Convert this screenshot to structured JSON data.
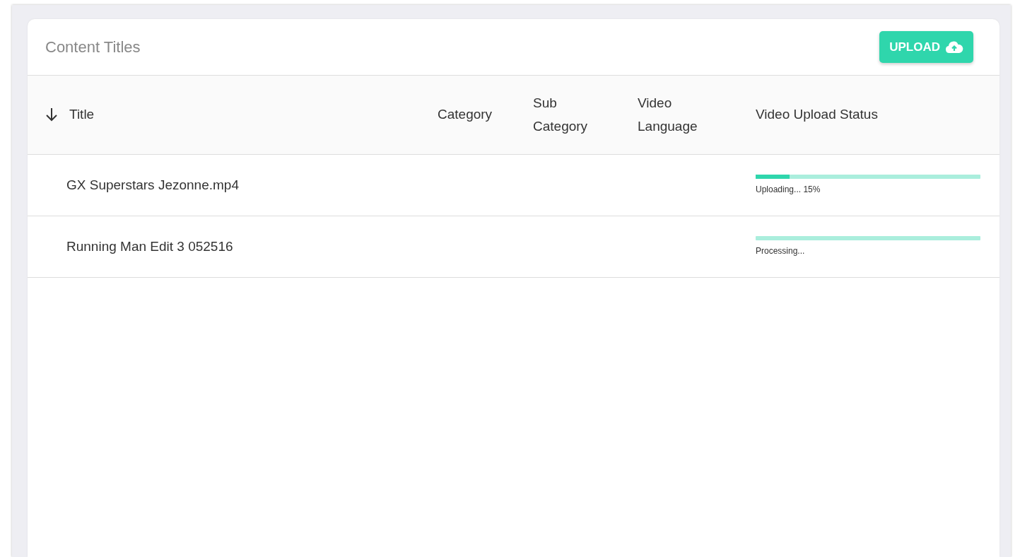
{
  "card": {
    "title": "Content Titles",
    "upload_button": "UPLOAD"
  },
  "table": {
    "columns": [
      {
        "label": "Title",
        "sorted": true
      },
      {
        "label": "Category",
        "sorted": false
      },
      {
        "label": "Sub Category",
        "sorted": false
      },
      {
        "label": "Video Language",
        "sorted": false
      },
      {
        "label": "Video Upload Status",
        "sorted": false
      }
    ],
    "rows": [
      {
        "title": "GX Superstars Jezonne.mp4",
        "status": {
          "level": 0.15,
          "text": "Uploading... 15%"
        }
      },
      {
        "title": "Running Man Edit 3 052516",
        "status": {
          "level": 0,
          "text": "Processing..."
        }
      }
    ]
  }
}
